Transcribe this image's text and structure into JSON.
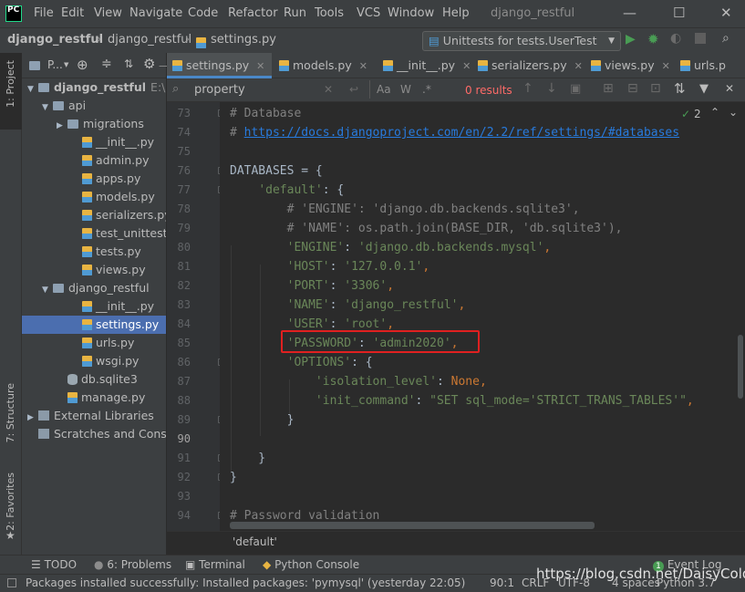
{
  "titlebar": {
    "logo": "PC",
    "menus": [
      "File",
      "Edit",
      "View",
      "Navigate",
      "Code",
      "Refactor",
      "Run",
      "Tools",
      "VCS",
      "Window",
      "Help"
    ],
    "project": "django_restful",
    "minimize": "—",
    "maximize": "☐",
    "close": "✕"
  },
  "navbar": {
    "crumbs": [
      "django_restful",
      "django_restful",
      "settings.py"
    ],
    "run_config": "Unittests for tests.UserTest"
  },
  "left_stripe": {
    "project": "1: Project",
    "structure": "7: Structure",
    "favorites": "2: Favorites"
  },
  "project_panel": {
    "title": "P...",
    "tree": [
      {
        "label": "django_restful",
        "extra": "E:\\d",
        "type": "folder",
        "open": true,
        "indent": 0,
        "bold": true
      },
      {
        "label": "api",
        "type": "folder",
        "open": true,
        "indent": 1
      },
      {
        "label": "migrations",
        "type": "folder",
        "open": false,
        "indent": 2
      },
      {
        "label": "__init__.py",
        "type": "py",
        "indent": 3
      },
      {
        "label": "admin.py",
        "type": "py",
        "indent": 3
      },
      {
        "label": "apps.py",
        "type": "py",
        "indent": 3
      },
      {
        "label": "models.py",
        "type": "py",
        "indent": 3
      },
      {
        "label": "serializers.py",
        "type": "py",
        "indent": 3
      },
      {
        "label": "test_unittest.p",
        "type": "py",
        "indent": 3
      },
      {
        "label": "tests.py",
        "type": "py",
        "indent": 3
      },
      {
        "label": "views.py",
        "type": "py",
        "indent": 3
      },
      {
        "label": "django_restful",
        "type": "folder",
        "open": true,
        "indent": 1
      },
      {
        "label": "__init__.py",
        "type": "py",
        "indent": 3
      },
      {
        "label": "settings.py",
        "type": "py",
        "indent": 3,
        "selected": true
      },
      {
        "label": "urls.py",
        "type": "py",
        "indent": 3
      },
      {
        "label": "wsgi.py",
        "type": "py",
        "indent": 3
      },
      {
        "label": "db.sqlite3",
        "type": "db",
        "indent": 2
      },
      {
        "label": "manage.py",
        "type": "py",
        "indent": 2
      },
      {
        "label": "External Libraries",
        "type": "lib",
        "open": false,
        "indent": 0
      },
      {
        "label": "Scratches and Cons",
        "type": "scratch",
        "indent": 0
      }
    ]
  },
  "tabs": [
    {
      "label": "settings.py",
      "active": true
    },
    {
      "label": "models.py"
    },
    {
      "label": "__init__.py"
    },
    {
      "label": "serializers.py"
    },
    {
      "label": "views.py"
    },
    {
      "label": "urls.p"
    }
  ],
  "search": {
    "query": "property",
    "results": "0 results",
    "match_case": "Aa",
    "words": "W",
    "regex": ".*"
  },
  "editor": {
    "inspections": "2",
    "lines": [
      {
        "n": "73",
        "tokens": [
          [
            "c",
            "# Database"
          ]
        ]
      },
      {
        "n": "74",
        "tokens": [
          [
            "c",
            "# "
          ],
          [
            "lnk",
            "https://docs.djangoproject.com/en/2.2/ref/settings/#databases"
          ]
        ]
      },
      {
        "n": "75",
        "tokens": []
      },
      {
        "n": "76",
        "tokens": [
          [
            "n",
            "DATABASES = {"
          ]
        ]
      },
      {
        "n": "77",
        "tokens": [
          [
            "n",
            "    "
          ],
          [
            "s",
            "'default'"
          ],
          [
            "n",
            ": {"
          ]
        ]
      },
      {
        "n": "78",
        "tokens": [
          [
            "n",
            "        "
          ],
          [
            "c",
            "# 'ENGINE': 'django.db.backends.sqlite3',"
          ]
        ]
      },
      {
        "n": "79",
        "tokens": [
          [
            "n",
            "        "
          ],
          [
            "c",
            "# 'NAME': os.path.join(BASE_DIR, 'db.sqlite3'),"
          ]
        ]
      },
      {
        "n": "80",
        "tokens": [
          [
            "n",
            "        "
          ],
          [
            "s",
            "'ENGINE'"
          ],
          [
            "n",
            ": "
          ],
          [
            "s",
            "'django.db.backends.mysql'"
          ],
          [
            "k",
            ","
          ]
        ]
      },
      {
        "n": "81",
        "tokens": [
          [
            "n",
            "        "
          ],
          [
            "s",
            "'HOST'"
          ],
          [
            "n",
            ": "
          ],
          [
            "s",
            "'127.0.0.1'"
          ],
          [
            "k",
            ","
          ]
        ]
      },
      {
        "n": "82",
        "tokens": [
          [
            "n",
            "        "
          ],
          [
            "s",
            "'PORT'"
          ],
          [
            "n",
            ": "
          ],
          [
            "s",
            "'3306'"
          ],
          [
            "k",
            ","
          ]
        ]
      },
      {
        "n": "83",
        "tokens": [
          [
            "n",
            "        "
          ],
          [
            "s",
            "'NAME'"
          ],
          [
            "n",
            ": "
          ],
          [
            "s",
            "'django_restful'"
          ],
          [
            "k",
            ","
          ]
        ]
      },
      {
        "n": "84",
        "tokens": [
          [
            "n",
            "        "
          ],
          [
            "s",
            "'USER'"
          ],
          [
            "n",
            ": "
          ],
          [
            "s",
            "'root'"
          ],
          [
            "k",
            ","
          ]
        ]
      },
      {
        "n": "85",
        "tokens": [
          [
            "n",
            "        "
          ],
          [
            "s",
            "'PASSWORD'"
          ],
          [
            "n",
            ": "
          ],
          [
            "s",
            "'admin2020'"
          ],
          [
            "k",
            ","
          ]
        ]
      },
      {
        "n": "86",
        "tokens": [
          [
            "n",
            "        "
          ],
          [
            "s",
            "'OPTIONS'"
          ],
          [
            "n",
            ": {"
          ]
        ]
      },
      {
        "n": "87",
        "tokens": [
          [
            "n",
            "            "
          ],
          [
            "s",
            "'isolation_level'"
          ],
          [
            "n",
            ": "
          ],
          [
            "k",
            "None"
          ],
          [
            "k",
            ","
          ]
        ]
      },
      {
        "n": "88",
        "tokens": [
          [
            "n",
            "            "
          ],
          [
            "s",
            "'init_command'"
          ],
          [
            "n",
            ": "
          ],
          [
            "s",
            "\"SET sql_mode='STRICT_TRANS_TABLES'\""
          ],
          [
            "k",
            ","
          ]
        ]
      },
      {
        "n": "89",
        "tokens": [
          [
            "n",
            "        }"
          ]
        ]
      },
      {
        "n": "90",
        "tokens": []
      },
      {
        "n": "91",
        "tokens": [
          [
            "n",
            "    }"
          ]
        ]
      },
      {
        "n": "92",
        "tokens": [
          [
            "n",
            "}"
          ]
        ]
      },
      {
        "n": "93",
        "tokens": []
      },
      {
        "n": "94",
        "tokens": [
          [
            "c",
            "# Password validation"
          ]
        ]
      }
    ],
    "current_line": "90",
    "breadcrumb": "'default'"
  },
  "tool_windows": [
    {
      "label": "TODO",
      "icon": "☰"
    },
    {
      "label": "6: Problems",
      "icon": "●"
    },
    {
      "label": "Terminal",
      "icon": "▣"
    },
    {
      "label": "Python Console",
      "icon": "◆"
    }
  ],
  "event_log": {
    "count": "1",
    "label": "Event Log"
  },
  "status": {
    "message": "Packages installed successfully: Installed packages: 'pymysql' (yesterday 22:05)",
    "position": "90:1",
    "line_sep": "CRLF",
    "encoding": "UTF-8",
    "indent": "4 spaces",
    "interpreter": "Python 3.7"
  },
  "watermark": "https://blog.csdn.net/DaisyCold"
}
